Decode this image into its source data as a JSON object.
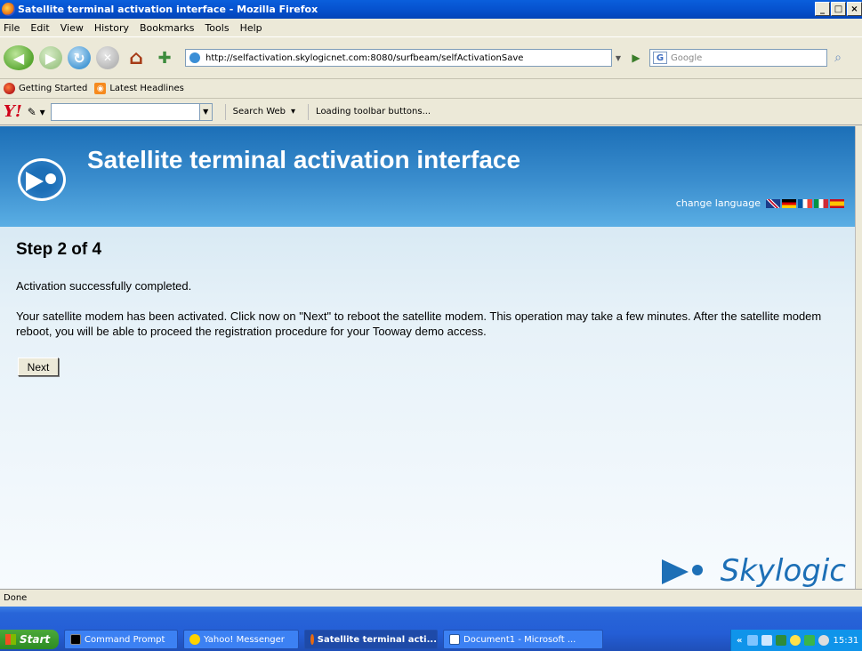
{
  "window": {
    "title": "Satellite terminal activation interface - Mozilla Firefox",
    "controls": [
      "_",
      "̈",
      "x"
    ]
  },
  "menu": {
    "items": [
      "File",
      "Edit",
      "View",
      "History",
      "Bookmarks",
      "Tools",
      "Help"
    ]
  },
  "navbar": {
    "url": "http://selfactivation.skylogicnet.com:8080/surfbeam/selfActivationSave",
    "search_engine": "G",
    "search_placeholder": "Google"
  },
  "bookmarks": {
    "items": [
      "Getting Started",
      "Latest Headlines"
    ]
  },
  "yahoo_toolbar": {
    "logo": "Y!",
    "search_label": "Search Web",
    "status": "Loading toolbar buttons..."
  },
  "page": {
    "banner_title": "Satellite terminal activation interface",
    "change_language": "change language",
    "step": "Step 2 of 4",
    "success_message": "Activation successfully completed.",
    "detail_message": "Your satellite modem has been activated. Click now on \"Next\" to reboot the satellite modem. This operation may take a few minutes. After the satellite modem reboot, you will be able to proceed the registration procedure for your Tooway demo access.",
    "next_label": "Next",
    "brand": "Skylogic"
  },
  "status": {
    "text": "Done"
  },
  "taskbar": {
    "start_label": "Start",
    "tasks": [
      {
        "label": "Command Prompt",
        "active": false
      },
      {
        "label": "Yahoo! Messenger",
        "active": false
      },
      {
        "label": "Satellite terminal acti...",
        "active": true
      },
      {
        "label": "Document1 - Microsoft ...",
        "active": false
      }
    ],
    "tray_chevron": "«",
    "clock": "15:31"
  },
  "colors": {
    "banner": "#1c6fb7",
    "brand": "#1d6fb6",
    "taskbar": "#245ed6"
  }
}
